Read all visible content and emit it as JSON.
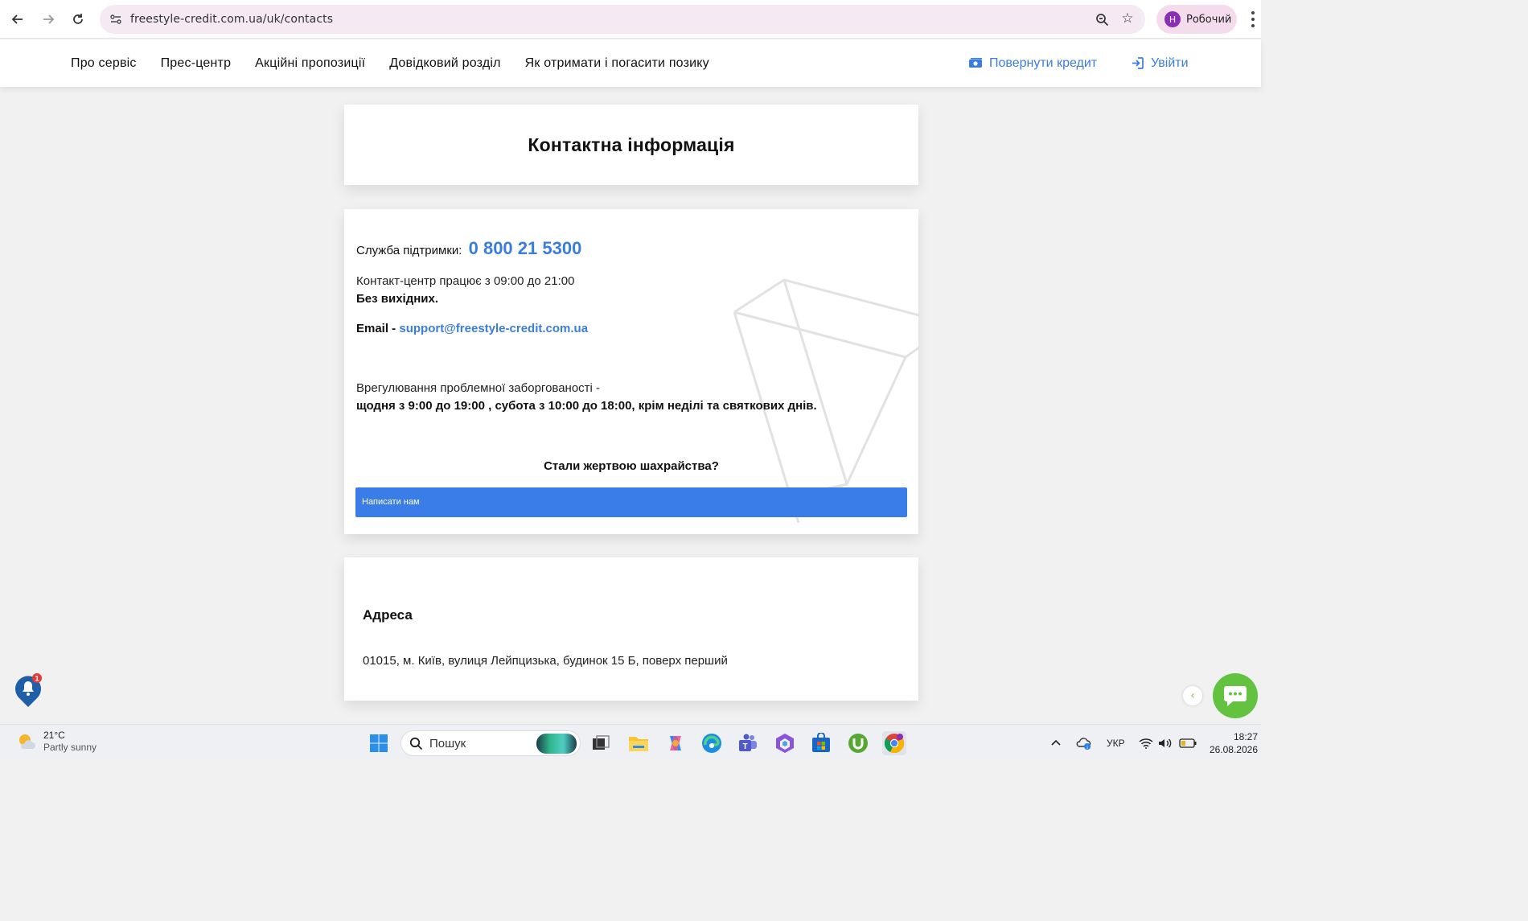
{
  "browser": {
    "url": "freestyle-credit.com.ua/uk/contacts",
    "profile_initial": "Н",
    "profile_name": "Робочий"
  },
  "header": {
    "nav": [
      "Про сервіс",
      "Прес-центр",
      "Акційні пропозиції",
      "Довідковий розділ",
      "Як отримати і погасити позику"
    ],
    "repay_label": "Повернути кредит",
    "login_label": "Увійти"
  },
  "page": {
    "title": "Контактна інформація"
  },
  "contacts": {
    "support_label": "Служба підтримки:",
    "support_phone": "0 800 21 5300",
    "hours": "Контакт-центр працює з 09:00 до 21:00",
    "no_weekends": "Без вихідних.",
    "email_label": "Email -",
    "email": "support@freestyle-credit.com.ua",
    "debt_label": "Врегулювання проблемної заборгованості -",
    "debt_hours": "щодня з 9:00 до 19:00 , субота з 10:00 до 18:00, крім неділі та святкових днів.",
    "fraud_question": "Стали жертвою шахрайства?",
    "write_button": "Написати нам"
  },
  "address": {
    "title": "Адреса",
    "text": "01015, м. Київ, вулиця Лейпцизька, будинок 15 Б, поверх перший"
  },
  "widgets": {
    "bell_count": "1"
  },
  "taskbar": {
    "temperature": "21°C",
    "weather": "Partly sunny",
    "search_placeholder": "Пошук",
    "language": "УКР",
    "time": "18:27",
    "date": "26.08.2026"
  },
  "colors": {
    "accent": "#3a7de1",
    "button": "#3a7de8",
    "chat": "#63c23f"
  }
}
